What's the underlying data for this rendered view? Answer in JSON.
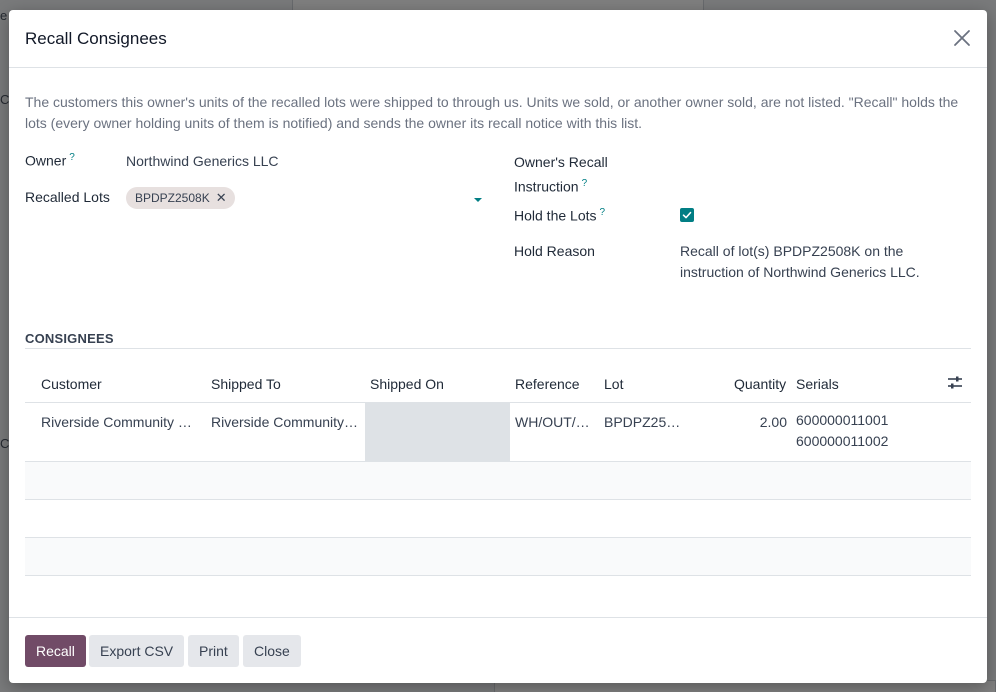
{
  "background": {
    "left_text_top": "e",
    "left_text_mid": "Co",
    "left_text_low": "Co"
  },
  "modal": {
    "title": "Recall Consignees",
    "intro": "The customers this owner's units of the recalled lots were shipped to through us. Units we sold, or another owner sold, are not listed. \"Recall\" holds the lots (every owner holding units of them is notified) and sends the owner its recall notice with this list."
  },
  "fields": {
    "owner_label": "Owner",
    "owner_value": "Northwind Generics LLC",
    "recalled_lots_label": "Recalled Lots",
    "recalled_lots_tags": [
      "BPDPZ2508K"
    ],
    "owner_instruction_label_line1": "Owner's Recall",
    "owner_instruction_label_line2": "Instruction",
    "hold_lots_label": "Hold the Lots",
    "hold_lots_checked": true,
    "hold_reason_label": "Hold Reason",
    "hold_reason_value": "Recall of lot(s) BPDPZ2508K on the instruction of Northwind Generics LLC.",
    "help_marker": "?"
  },
  "consignees": {
    "section_title": "CONSIGNEES",
    "columns": [
      "Customer",
      "Shipped To",
      "Shipped On",
      "Reference",
      "Lot",
      "Quantity",
      "Serials"
    ],
    "rows": [
      {
        "customer": "Riverside Community …",
        "shipped_to": "Riverside Community…",
        "shipped_on": "",
        "reference": "WH/OUT/…",
        "lot": "BPDPZ25…",
        "quantity": "2.00",
        "serials": [
          "600000011001",
          "600000011002"
        ]
      }
    ]
  },
  "footer": {
    "recall": "Recall",
    "export_csv": "Export CSV",
    "print": "Print",
    "close": "Close"
  },
  "colors": {
    "primary": "#714b67",
    "accent": "#017e84"
  }
}
